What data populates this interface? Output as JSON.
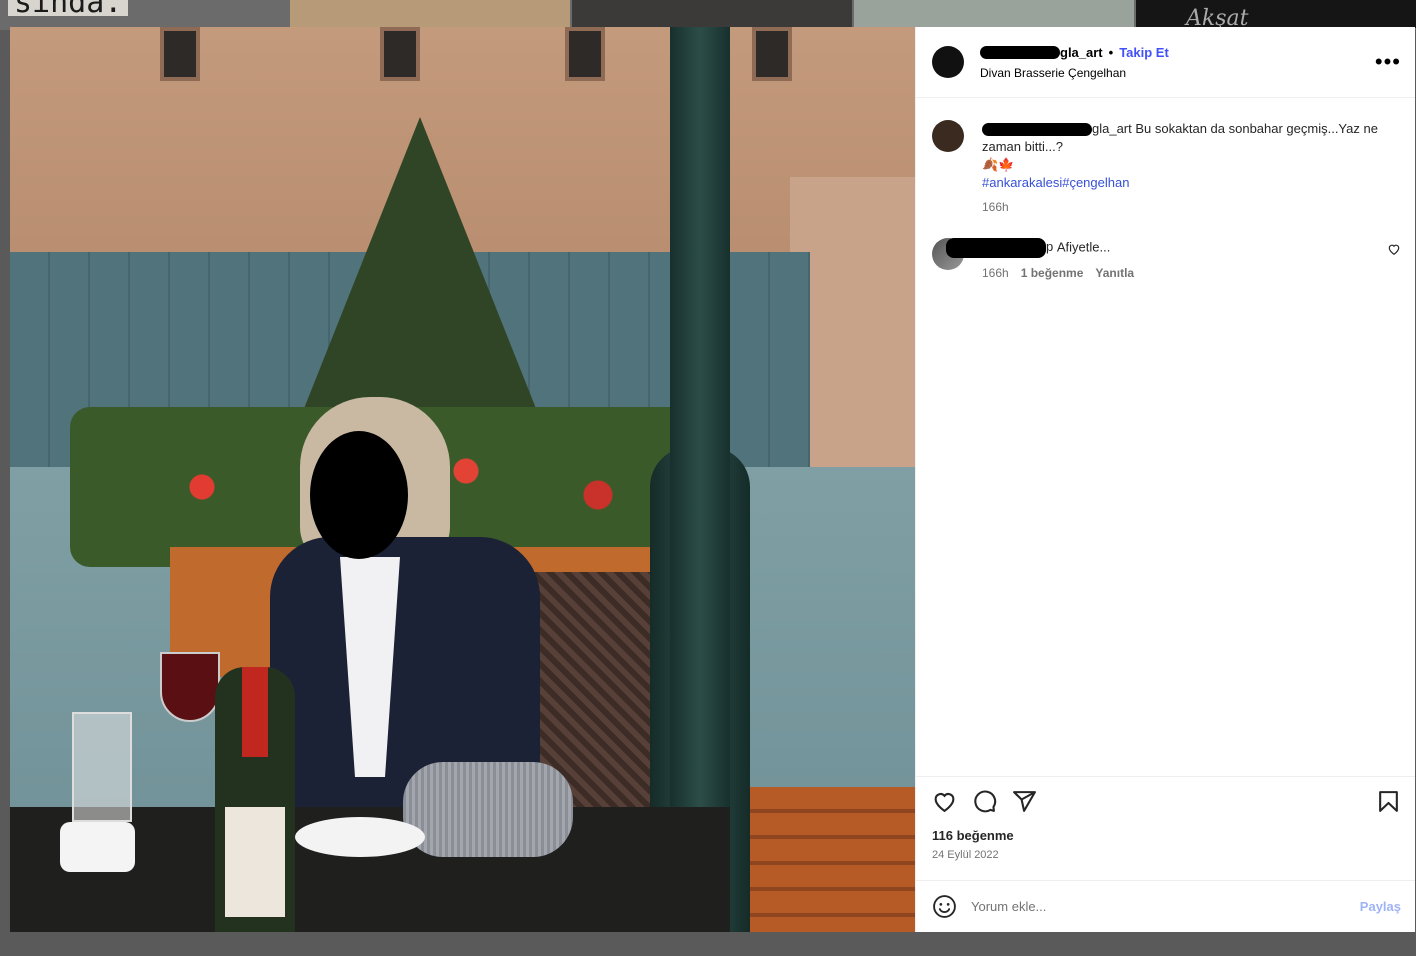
{
  "background": {
    "left_text": "sında.",
    "right_text": "Akşat"
  },
  "post": {
    "username_suffix": "gla_art",
    "follow_label": "Takip Et",
    "location": "Divan Brasserie Çengelhan",
    "caption": {
      "username_suffix": "gla_art",
      "text": "Bu sokaktan da sonbahar geçmiş...Yaz ne zaman bitti...?",
      "emojis": "🍂🍁",
      "hashtags": "#ankarakalesi#çengelhan",
      "time": "166h"
    },
    "comments": [
      {
        "username_suffix": "p",
        "text": "Afiyetle...",
        "time": "166h",
        "likes": "1 beğenme",
        "reply": "Yanıtla"
      }
    ],
    "likes": "116 beğenme",
    "date": "24 Eylül 2022",
    "comment_placeholder": "Yorum ekle...",
    "share_label": "Paylaş"
  }
}
